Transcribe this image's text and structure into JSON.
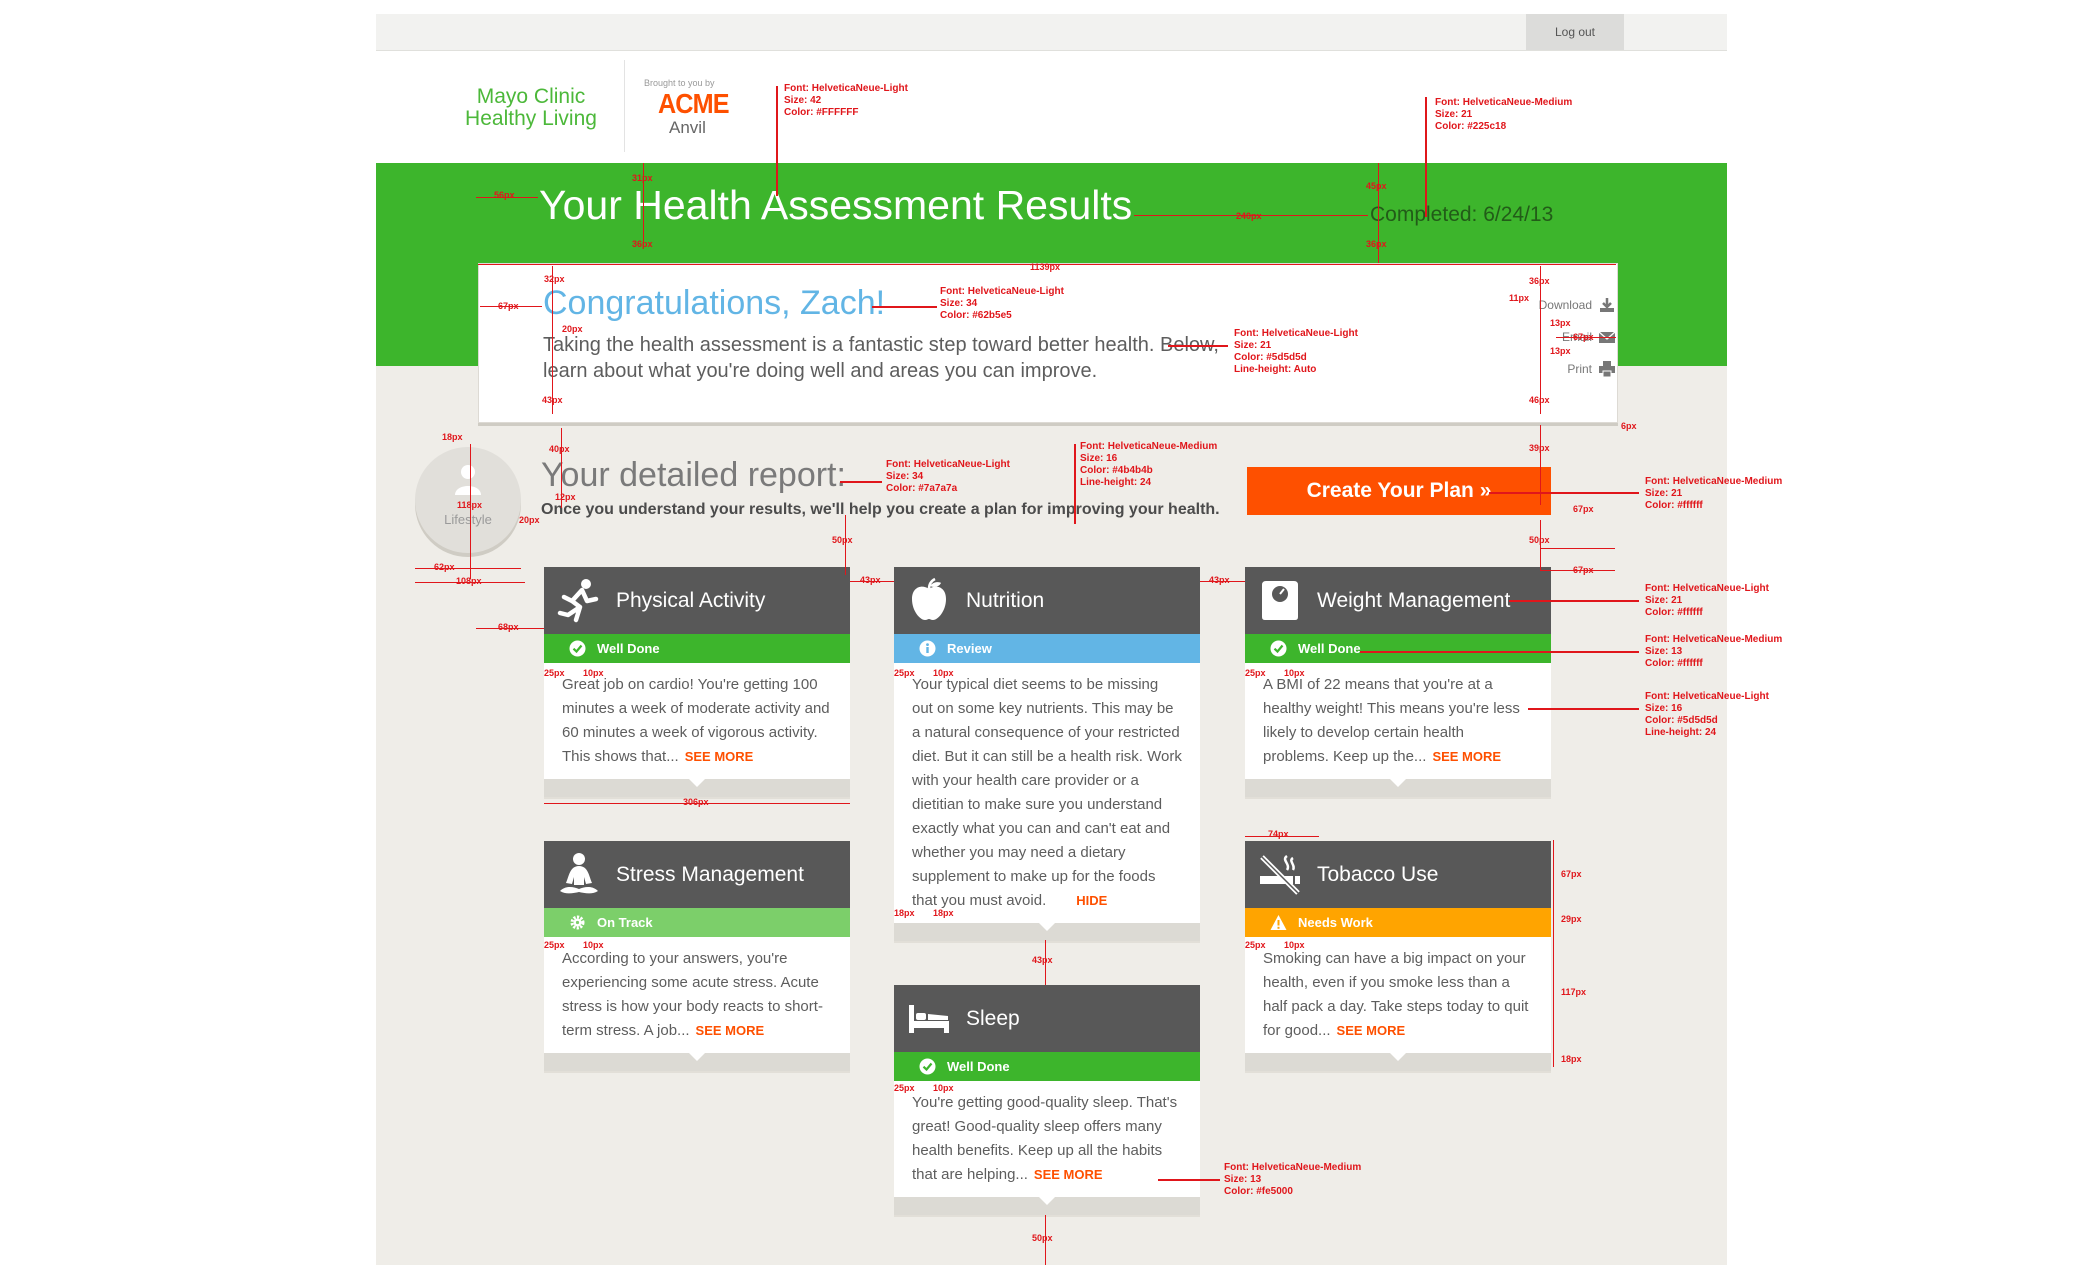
{
  "topbar": {
    "logout_label": "Log out"
  },
  "header": {
    "brand_line1": "Mayo Clinic",
    "brand_line2": "Healthy Living",
    "brought_by": "Brought to you by",
    "sponsor_name": "ACME",
    "sponsor_sub": "Anvil"
  },
  "hero": {
    "title": "Your Health Assessment Results",
    "completed": "Completed: 6/24/13"
  },
  "congrats": {
    "title": "Congratulations, Zach!",
    "body": "Taking the health assessment is a fantastic step toward better health. Below, learn about what you're doing well and areas you can improve.",
    "actions": {
      "download": "Download",
      "email": "Email",
      "print": "Print"
    }
  },
  "report": {
    "category": "Lifestyle",
    "title": "Your detailed report:",
    "subtitle": "Once you understand your results, we'll help you create a plan for improving your health.",
    "cta": "Create Your Plan »"
  },
  "cards": {
    "physical": {
      "icon": "runner-icon",
      "title": "Physical Activity",
      "status": "Well Done",
      "status_color": "#3db52c",
      "body": "Great job on cardio! You're getting 100 minutes a week of moderate activity and 60 minutes a week of vigorous activity. This shows that...",
      "link": "SEE MORE"
    },
    "nutrition": {
      "icon": "apple-icon",
      "title": "Nutrition",
      "status": "Review",
      "status_color": "#62b5e5",
      "body": "Your typical diet seems to be missing out on some key nutrients. This may be a natural consequence of your restricted diet. But it can still be a health risk. Work with your health care provider or a dietitian to make sure you understand exactly what you can and can't eat and whether you may need a dietary supplement to make up for the foods that you must avoid.",
      "link": "HIDE"
    },
    "weight": {
      "icon": "scale-icon",
      "title": "Weight Management",
      "status": "Well Done",
      "status_color": "#3db52c",
      "body": "A BMI of 22 means that you're at a healthy weight! This means you're less likely to develop certain health problems. Keep up the...",
      "link": "SEE MORE"
    },
    "stress": {
      "icon": "meditation-icon",
      "title": "Stress Management",
      "status": "On Track",
      "status_color": "#7ccf6a",
      "body": "According to your answers, you're experiencing some acute stress. Acute stress is how your body reacts to short-term stress. A job...",
      "link": "SEE MORE"
    },
    "tobacco": {
      "icon": "no-smoking-icon",
      "title": "Tobacco Use",
      "status": "Needs Work",
      "status_color": "#ffa400",
      "body": "Smoking can have a big impact on your health, even if you smoke less than a half pack a day. Take steps today to quit for good...",
      "link": "SEE MORE"
    },
    "sleep": {
      "icon": "bed-icon",
      "title": "Sleep",
      "status": "Well Done",
      "status_color": "#3db52c",
      "body": "You're getting good-quality sleep. That's great! Good-quality sleep offers many health benefits. Keep up all the habits that are helping...",
      "link": "SEE MORE"
    }
  },
  "annotations": {
    "title_font": [
      "Font: HelveticaNeue-Light",
      "Size: 42",
      "Color: #FFFFFF"
    ],
    "completed_font": [
      "Font: HelveticaNeue-Medium",
      "Size: 21",
      "Color: #225c18"
    ],
    "congrats_font": [
      "Font: HelveticaNeue-Light",
      "Size: 34",
      "Color: #62b5e5"
    ],
    "intro_font": [
      "Font: HelveticaNeue-Light",
      "Size: 21",
      "Color: #5d5d5d",
      "Line-height: Auto"
    ],
    "report_title_font": [
      "Font: HelveticaNeue-Light",
      "Size: 34",
      "Color: #7a7a7a"
    ],
    "report_sub_font": [
      "Font: HelveticaNeue-Medium",
      "Size: 16",
      "Color: #4b4b4b",
      "Line-height: 24"
    ],
    "cta_font": [
      "Font: HelveticaNeue-Medium",
      "Size: 21",
      "Color: #ffffff"
    ],
    "card_title_font": [
      "Font: HelveticaNeue-Light",
      "Size: 21",
      "Color: #ffffff"
    ],
    "status_font": [
      "Font: HelveticaNeue-Medium",
      "Size: 13",
      "Color: #ffffff"
    ],
    "card_body_font": [
      "Font: HelveticaNeue-Light",
      "Size: 16",
      "Color: #5d5d5d",
      "Line-height: 24"
    ],
    "link_font": [
      "Font: HelveticaNeue-Medium",
      "Size: 13",
      "Color: #fe5000"
    ],
    "dims": {
      "d_56": "56px",
      "d_31": "31px",
      "d_36a": "36px",
      "d_240": "240px",
      "d_45": "45px",
      "d_36b": "36px",
      "d_1139": "1139px",
      "d_32": "32px",
      "d_36c": "36px",
      "d_67a": "67px",
      "d_11": "11px",
      "d_20a": "20px",
      "d_13a": "13px",
      "d_67b": "67px",
      "d_13b": "13px",
      "d_43a": "43px",
      "d_46": "46px",
      "d_6": "6px",
      "d_18a": "18px",
      "d_40": "40px",
      "d_39": "39px",
      "d_12": "12px",
      "d_118": "118px",
      "d_20b": "20px",
      "d_50a": "50px",
      "d_67c": "67px",
      "d_50b": "50px",
      "d_62": "62px",
      "d_108": "108px",
      "d_43b": "43px",
      "d_43c": "43px",
      "d_67d": "67px",
      "d_68": "68px",
      "d_25a": "25px",
      "d_10a": "10px",
      "d_25b": "25px",
      "d_10b": "10px",
      "d_25c": "25px",
      "d_10c": "10px",
      "d_306": "306px",
      "d_74": "74px",
      "d_67e": "67px",
      "d_18b": "18px",
      "d_18c": "18px",
      "d_29": "29px",
      "d_25d": "25px",
      "d_10d": "10px",
      "d_25e": "25px",
      "d_10e": "10px",
      "d_117": "117px",
      "d_43d": "43px",
      "d_18d": "18px",
      "d_25f": "25px",
      "d_10f": "10px",
      "d_50c": "50px"
    }
  }
}
